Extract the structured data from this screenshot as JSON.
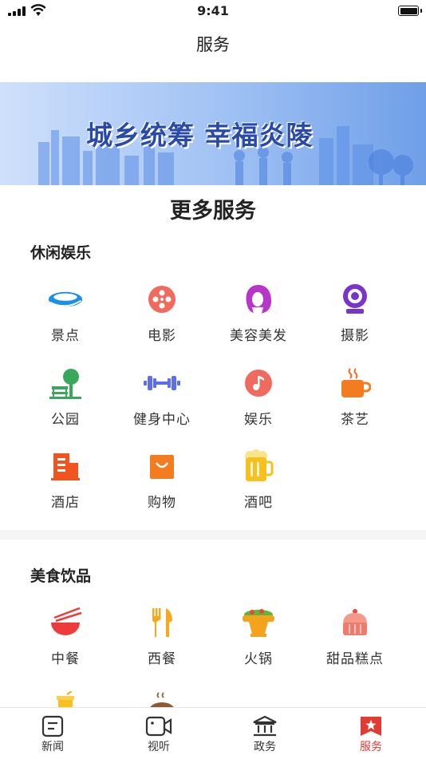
{
  "status_bar": {
    "time": "9:41"
  },
  "nav": {
    "title": "服务"
  },
  "banner": {
    "text": "城乡统筹 幸福炎陵"
  },
  "main": {
    "title": "更多服务"
  },
  "sections": [
    {
      "title": "休闲娱乐",
      "items": [
        {
          "label": "景点",
          "icon": "scenic-spot-icon"
        },
        {
          "label": "电影",
          "icon": "film-reel-icon"
        },
        {
          "label": "美容美发",
          "icon": "hair-beauty-icon"
        },
        {
          "label": "摄影",
          "icon": "camera-icon"
        },
        {
          "label": "公园",
          "icon": "park-icon"
        },
        {
          "label": "健身中心",
          "icon": "dumbbell-icon"
        },
        {
          "label": "娱乐",
          "icon": "music-note-icon"
        },
        {
          "label": "茶艺",
          "icon": "tea-cup-icon"
        },
        {
          "label": "酒店",
          "icon": "hotel-icon"
        },
        {
          "label": "购物",
          "icon": "shopping-bag-icon"
        },
        {
          "label": "酒吧",
          "icon": "beer-mug-icon"
        }
      ]
    },
    {
      "title": "美食饮品",
      "items": [
        {
          "label": "中餐",
          "icon": "bowl-chopsticks-icon"
        },
        {
          "label": "西餐",
          "icon": "fork-knife-icon"
        },
        {
          "label": "火锅",
          "icon": "hot-pot-icon"
        },
        {
          "label": "甜品糕点",
          "icon": "cake-icon"
        }
      ]
    }
  ],
  "tabbar": [
    {
      "label": "新闻",
      "icon": "news-icon"
    },
    {
      "label": "视听",
      "icon": "video-icon"
    },
    {
      "label": "政务",
      "icon": "government-icon"
    },
    {
      "label": "服务",
      "icon": "service-icon"
    }
  ],
  "colors": {
    "accent": "#e23b33"
  }
}
